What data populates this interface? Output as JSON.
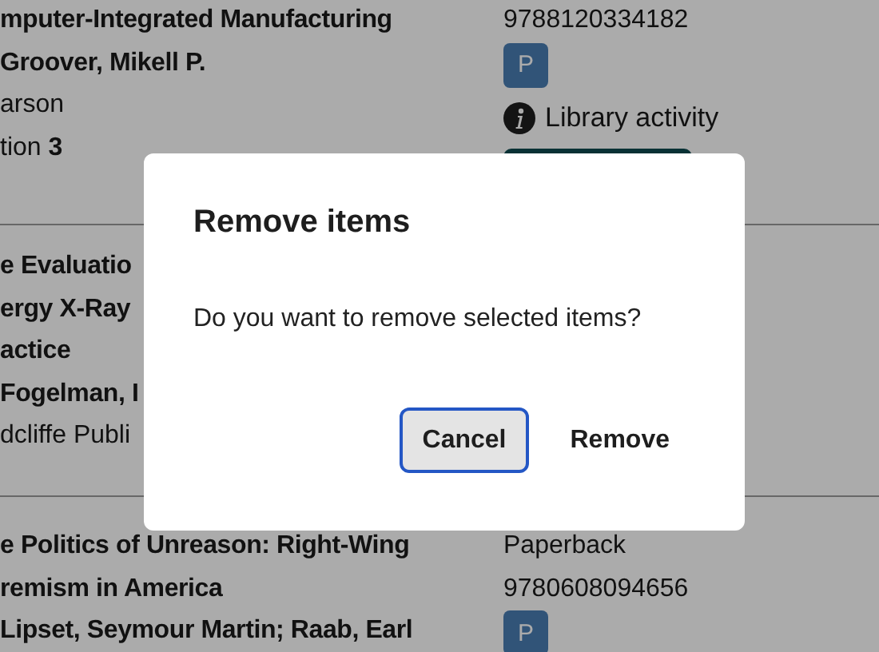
{
  "items": [
    {
      "left": [
        {
          "kind": "title",
          "text": "mputer-Integrated Manufacturing"
        },
        {
          "kind": "author",
          "text": "Groover, Mikell P."
        },
        {
          "kind": "plain",
          "text": "arson"
        },
        {
          "kind": "plain",
          "text": "tion **3**"
        }
      ],
      "right": [
        {
          "kind": "text",
          "text": "9788120334182"
        },
        {
          "kind": "badge",
          "text": "P"
        },
        {
          "kind": "activity",
          "text": "Library activity"
        },
        {
          "kind": "button"
        }
      ]
    },
    {
      "left": [
        {
          "kind": "title",
          "text": "e Evaluatio"
        },
        {
          "kind": "title",
          "text": "ergy X-Ray"
        },
        {
          "kind": "title",
          "text": "actice"
        },
        {
          "kind": "author",
          "text": "Fogelman, I"
        },
        {
          "kind": "plain",
          "text": "dcliffe Publi"
        }
      ]
    },
    {
      "left": [
        {
          "kind": "title",
          "text": "e Politics of Unreason: Right-Wing"
        },
        {
          "kind": "title",
          "text": "remism in America"
        },
        {
          "kind": "author",
          "text": "Lipset, Seymour Martin; Raab, Earl"
        }
      ],
      "right": [
        {
          "kind": "text",
          "text": "Paperback"
        },
        {
          "kind": "text",
          "text": "9780608094656"
        },
        {
          "kind": "badge",
          "text": "P"
        }
      ]
    }
  ],
  "dialog": {
    "title": "Remove items",
    "message": "Do you want to remove selected items?",
    "buttons": [
      {
        "label": "Cancel",
        "focused": true
      },
      {
        "label": "Remove",
        "focused": false
      }
    ]
  }
}
